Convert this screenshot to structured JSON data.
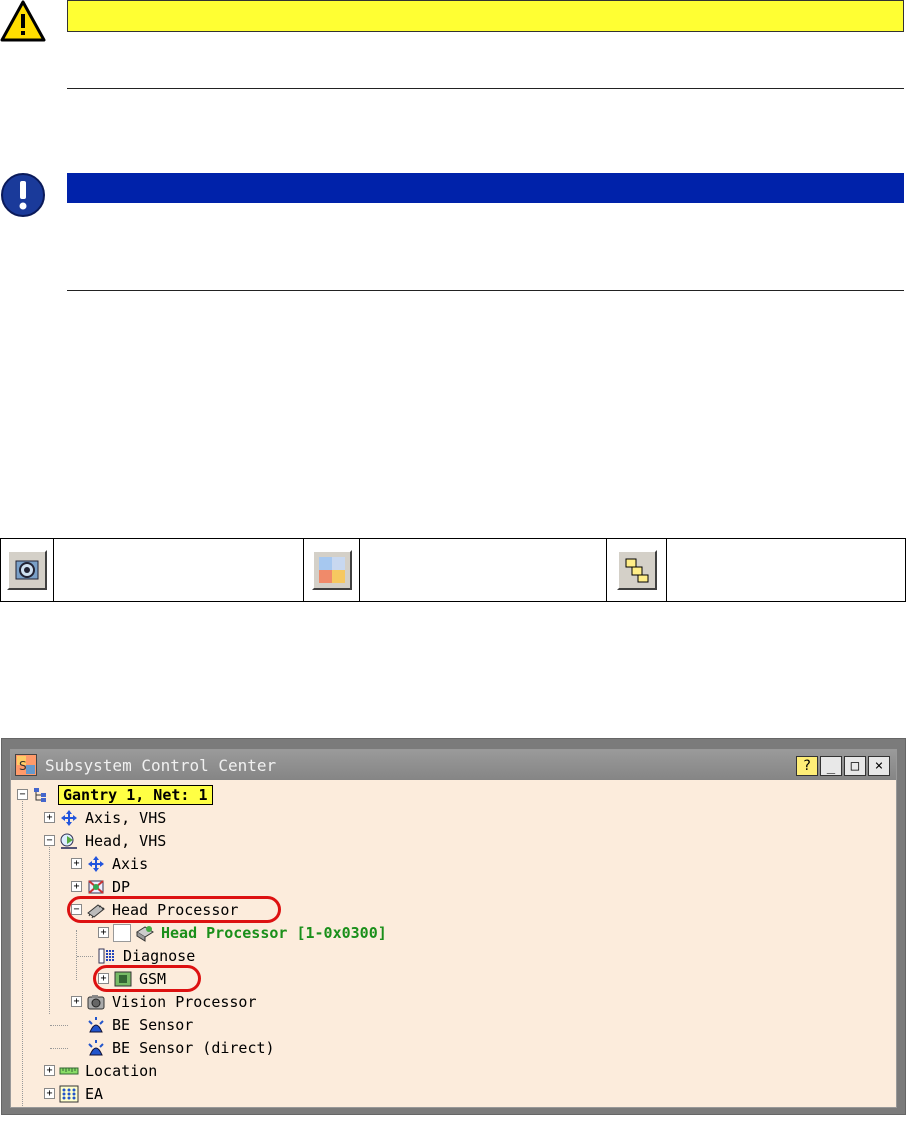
{
  "icon_table": [
    {
      "icon": "module-gear-icon"
    },
    {
      "icon": "color-quad-icon"
    },
    {
      "icon": "hierarchy-icon"
    }
  ],
  "window": {
    "title": "Subsystem Control Center",
    "help_btn": "?",
    "min_btn": "_",
    "max_btn": "□",
    "close_btn": "×"
  },
  "tree": {
    "root": "Gantry 1, Net: 1",
    "axis_vhs": "Axis, VHS",
    "head_vhs": "Head, VHS",
    "axis": "Axis",
    "dp": "DP",
    "head_processor": "Head Processor",
    "head_processor_node": "Head Processor [1-0x0300]",
    "diagnose": "Diagnose",
    "gsm": "GSM",
    "vision_processor": "Vision Processor",
    "be_sensor": "BE Sensor",
    "be_sensor_direct": "BE Sensor (direct)",
    "location": "Location",
    "ea": "EA",
    "expand": "+",
    "collapse": "−"
  },
  "colors": {
    "warning_bar": "#ffff33",
    "important_bar": "#0022aa",
    "highlight": "#ffff44",
    "annotation": "#dd1111",
    "tree_background": "#fcecdc"
  }
}
